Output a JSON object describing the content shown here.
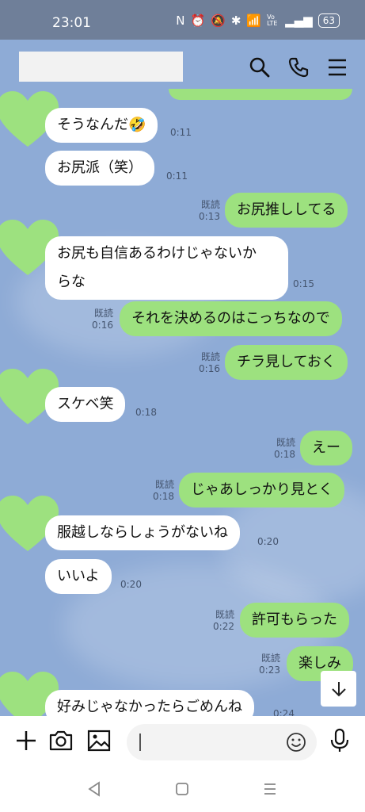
{
  "status": {
    "time": "23:01",
    "icons": [
      "N",
      "⏰",
      "🔕",
      "✱",
      "📶",
      "Vo LTE",
      "▂▄▆"
    ],
    "battery": "63"
  },
  "header": {
    "contact_name": ""
  },
  "messages": [
    {
      "side": "in",
      "text": "そうなんだ🤣",
      "time": "0:11"
    },
    {
      "side": "in",
      "text": "お尻派（笑）",
      "time": "0:11"
    },
    {
      "side": "out",
      "read": "既読",
      "text": "お尻推ししてる",
      "time": "0:13"
    },
    {
      "side": "in",
      "text": "お尻も自信あるわけじゃないか",
      "text2": "らな",
      "time": "0:15"
    },
    {
      "side": "out",
      "read": "既読",
      "text": "それを決めるのはこっちなので",
      "time": "0:16"
    },
    {
      "side": "out",
      "read": "既読",
      "text": "チラ見しておく",
      "time": "0:16"
    },
    {
      "side": "in",
      "text": "スケベ笑",
      "time": "0:18"
    },
    {
      "side": "out",
      "read": "既読",
      "text": "えー",
      "time": "0:18"
    },
    {
      "side": "out",
      "read": "既読",
      "text": "じゃあしっかり見とく",
      "time": "0:18"
    },
    {
      "side": "in",
      "text": "服越しならしょうがないね",
      "time": "0:20"
    },
    {
      "side": "in",
      "text": "いいよ",
      "time": "0:20"
    },
    {
      "side": "out",
      "read": "既読",
      "text": "許可もらった",
      "time": "0:22"
    },
    {
      "side": "out",
      "read": "既読",
      "text": "楽しみ",
      "time": "0:23"
    },
    {
      "side": "in",
      "text": "好みじゃなかったらごめんね",
      "time": "0:24"
    }
  ],
  "colors": {
    "chat_bg": "#8eabd6",
    "out_bubble": "#9de17f",
    "in_bubble": "#ffffff",
    "heart": "#9de17f",
    "status_bg": "#6f7f99"
  },
  "icons": [
    "search-icon",
    "phone-icon",
    "menu-icon",
    "plus-icon",
    "camera-icon",
    "image-icon",
    "emoji-icon",
    "mic-icon",
    "arrow-down-icon",
    "back-icon",
    "home-icon",
    "recents-icon"
  ]
}
